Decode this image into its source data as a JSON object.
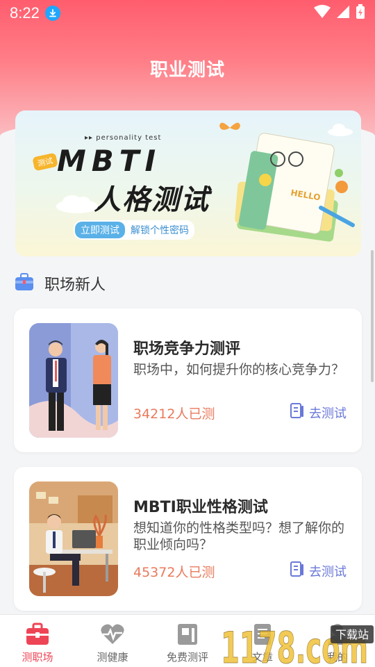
{
  "status": {
    "time": "8:22"
  },
  "header": {
    "title": "职业测试"
  },
  "banner": {
    "tagline": "▸▸ personality test",
    "tag": "测试",
    "title_en": "MBTI",
    "title_zh": "人格测试",
    "button_label": "立即测试",
    "button_desc": "解锁个性密码",
    "notebook_text": "HELLO"
  },
  "section": {
    "title": "职场新人"
  },
  "cards": [
    {
      "title": "职场竞争力测评",
      "desc": "职场中，如何提升你的核心竞争力？",
      "count": "34212人已测",
      "action": "去测试"
    },
    {
      "title": "MBTI职业性格测试",
      "desc": "想知道你的性格类型吗？想了解你的职业倾向吗？",
      "count": "45372人已测",
      "action": "去测试"
    }
  ],
  "nav": {
    "items": [
      {
        "label": "测职场",
        "icon": "briefcase-icon",
        "active": true
      },
      {
        "label": "测健康",
        "icon": "heartbeat-icon",
        "active": false
      },
      {
        "label": "免费测评",
        "icon": "test-paper-icon",
        "active": false
      },
      {
        "label": "文章",
        "icon": "article-icon",
        "active": false
      },
      {
        "label": "我的",
        "icon": "profile-icon",
        "active": false
      }
    ]
  },
  "watermark": {
    "text": "1178.com",
    "badge": "下载站"
  },
  "colors": {
    "accent": "#ee4556",
    "header_top": "#ff5d6e",
    "count": "#e97a5c",
    "action": "#6a78d8"
  }
}
